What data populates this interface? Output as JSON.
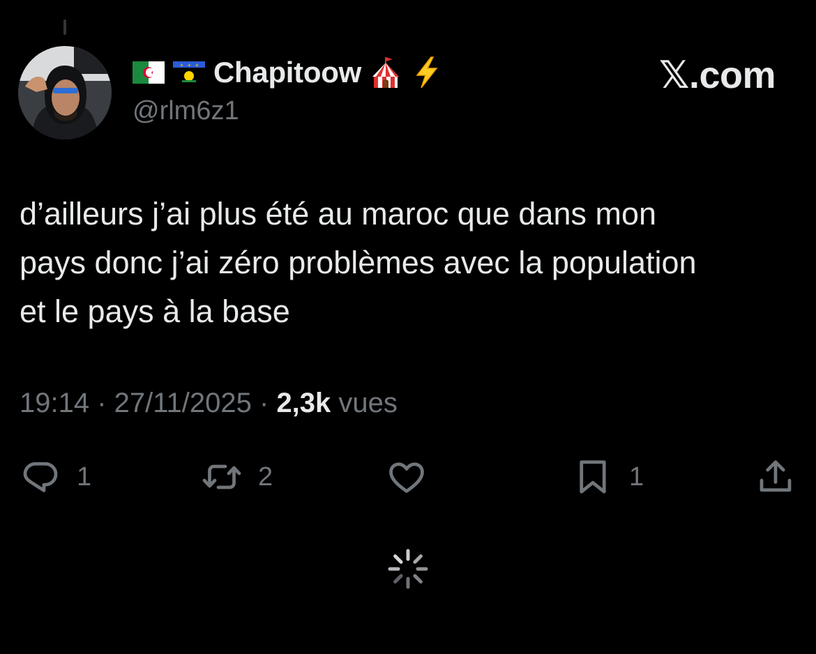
{
  "author": {
    "display_name": "Chapitoow",
    "handle": "@rlm6z1",
    "flag_icons": [
      "algeria-flag-icon",
      "guadeloupe-flag-icon"
    ],
    "emoji_icons": [
      "circus-tent-icon",
      "lightning-icon"
    ]
  },
  "brand": {
    "label": "𝕏.com"
  },
  "tweet": {
    "lines": [
      "d’ailleurs j’ai plus été au maroc que dans mon",
      "pays donc j’ai zéro problèmes avec la population",
      "et le pays à la base"
    ]
  },
  "meta": {
    "time": "19:14",
    "separator": " · ",
    "date": "27/11/2025",
    "views_count": "2,3k",
    "views_label": " vues"
  },
  "actions": {
    "reply_count": "1",
    "retweet_count": "2",
    "like_count": "",
    "bookmark_count": "1"
  },
  "colors": {
    "background": "#000000",
    "primary_text": "#e7e9ea",
    "secondary_text": "#71767b"
  }
}
